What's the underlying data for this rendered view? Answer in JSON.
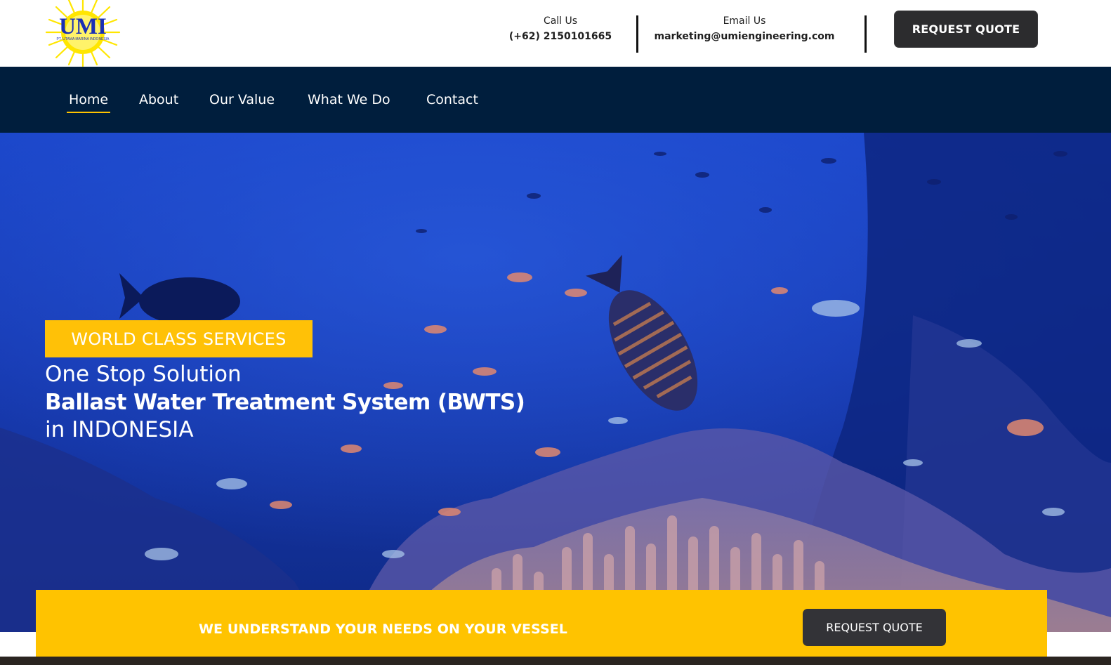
{
  "brand": {
    "logo_text": "UMI",
    "logo_subtext": "PT. UTAMA MARINA INDONESIA",
    "logo_colors": {
      "text": "#1a2fb5",
      "sun": "#ffe600",
      "subtext": "#1a2fb5"
    }
  },
  "header": {
    "call": {
      "label": "Call Us",
      "value": "(+62) 2150101665"
    },
    "email": {
      "label": "Email Us",
      "value": "marketing@umiengineering.com"
    },
    "request_quote_label": "REQUEST QUOTE"
  },
  "nav": {
    "items": [
      {
        "label": "Home",
        "active": true
      },
      {
        "label": "About",
        "active": false
      },
      {
        "label": "Our Value",
        "active": false
      },
      {
        "label": "What We Do",
        "active": false
      },
      {
        "label": "Contact",
        "active": false
      }
    ]
  },
  "hero": {
    "badge": "WORLD CLASS SERVICES",
    "line1": "One Stop Solution",
    "line2": "Ballast Water Treatment System (BWTS)",
    "line3": "in INDONESIA",
    "background": "underwater-reef-photo"
  },
  "banner": {
    "text": "WE UNDERSTAND YOUR NEEDS ON YOUR VESSEL",
    "request_quote_label": "REQUEST QUOTE"
  },
  "colors": {
    "nav_bg": "#001e3d",
    "accent_yellow": "#ffc300",
    "button_dark": "#2c2c2e",
    "hero_blue": "#1537a8"
  }
}
